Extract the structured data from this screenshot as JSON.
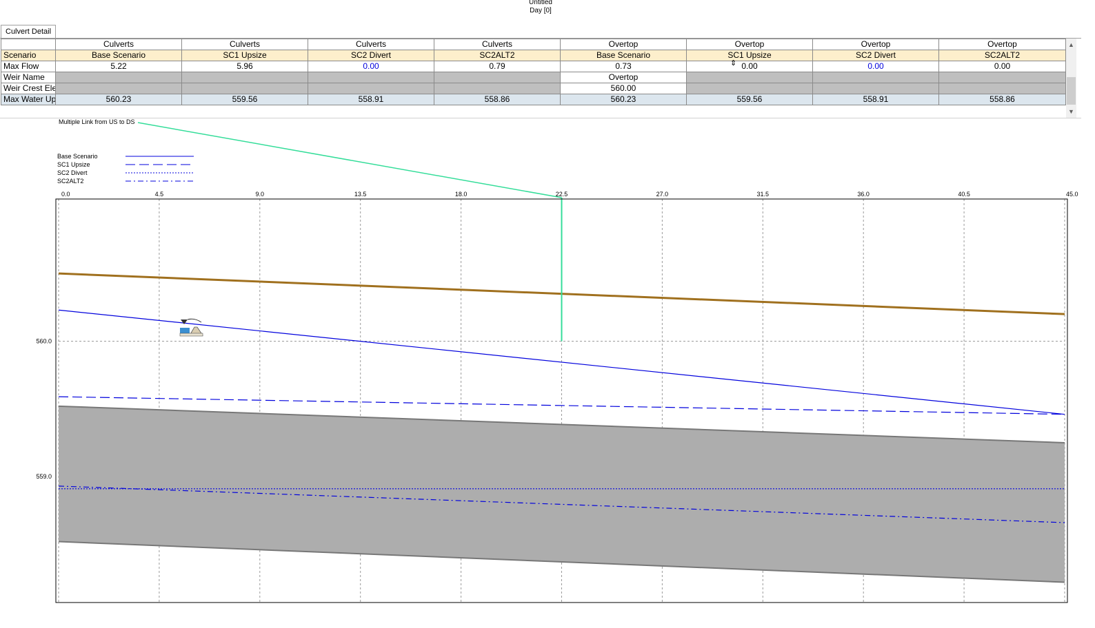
{
  "header": {
    "title": "Untitled",
    "subtitle": "Day [0]"
  },
  "tab": {
    "label": "Culvert Detail"
  },
  "grid": {
    "group_headers": [
      "Culverts",
      "Culverts",
      "Culverts",
      "Culverts",
      "Overtop",
      "Overtop",
      "Overtop",
      "Overtop"
    ],
    "scenario_label": "Scenario",
    "scenarios": [
      "Base Scenario",
      "SC1 Upsize",
      "SC2 Divert",
      "SC2ALT2",
      "Base Scenario",
      "SC1 Upsize",
      "SC2 Divert",
      "SC2ALT2"
    ],
    "max_flow_label": "Max Flow",
    "max_flow": [
      "5.22",
      "5.96",
      "0.00",
      "0.79",
      "0.73",
      "0.00",
      "0.00",
      "0.00"
    ],
    "weir_name_label": "Weir Name",
    "weir_name": [
      "",
      "",
      "",
      "",
      "Overtop",
      "",
      "",
      ""
    ],
    "weir_crest_label": "Weir Crest Ele",
    "weir_crest": [
      "",
      "",
      "",
      "",
      "560.00",
      "",
      "",
      ""
    ],
    "max_water_label": "Max Water Up",
    "max_water": [
      "560.23",
      "559.56",
      "558.91",
      "558.86",
      "560.23",
      "559.56",
      "558.91",
      "558.86"
    ]
  },
  "chart_data": {
    "type": "line",
    "title": "Multiple Link from US to DS",
    "x_ticks": [
      "0.0",
      "4.5",
      "9.0",
      "13.5",
      "18.0",
      "22.5",
      "27.0",
      "31.5",
      "36.0",
      "40.5",
      "45.0"
    ],
    "y_ticks": [
      "560.0",
      "559.0"
    ],
    "xlim": [
      0,
      45
    ],
    "ylim": [
      558.07,
      561.05
    ],
    "grid": true,
    "legend_position": "top-left",
    "series": [
      {
        "name": "Base Scenario",
        "style": "solid",
        "color": "#0000dd",
        "x": [
          0,
          45
        ],
        "y": [
          560.23,
          559.46
        ]
      },
      {
        "name": "SC1 Upsize",
        "style": "dash",
        "color": "#0000dd",
        "x": [
          0,
          45
        ],
        "y": [
          559.59,
          559.46
        ]
      },
      {
        "name": "SC2 Divert",
        "style": "dot",
        "color": "#0000dd",
        "x": [
          0,
          45
        ],
        "y": [
          558.91,
          558.91
        ]
      },
      {
        "name": "SC2ALT2",
        "style": "dashdot",
        "color": "#0000dd",
        "x": [
          0,
          45
        ],
        "y": [
          558.93,
          558.66
        ]
      }
    ],
    "road_profile": {
      "color": "#a0701e",
      "x": [
        0,
        45
      ],
      "y": [
        560.5,
        560.2
      ]
    },
    "culvert_top": {
      "x": [
        0,
        45
      ],
      "y": [
        559.52,
        559.25
      ]
    },
    "culvert_bottom": {
      "x": [
        0,
        45
      ],
      "y": [
        558.52,
        558.22
      ]
    },
    "cursor_x": 22.5,
    "culvert_fill_color": "#adadad",
    "cursor_color": "#33dd99"
  }
}
